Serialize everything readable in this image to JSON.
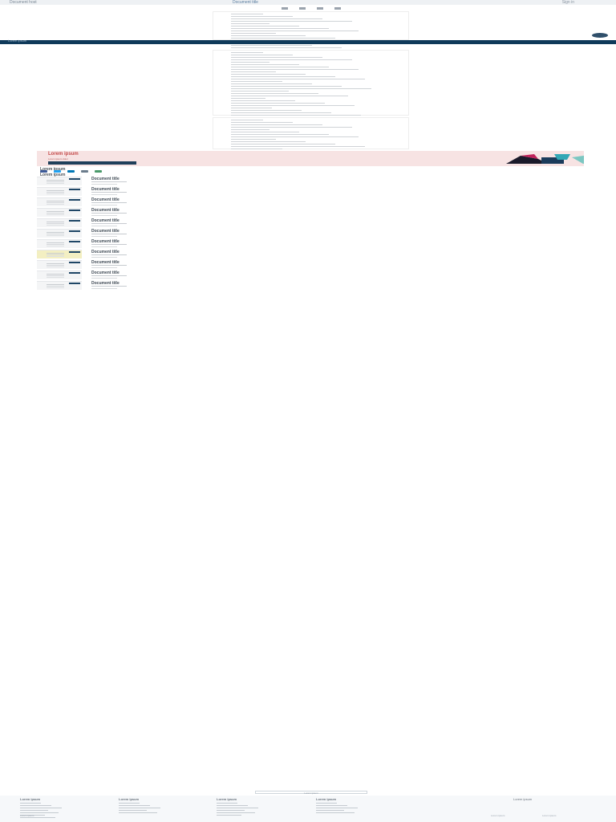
{
  "header": {
    "brand": "Document host",
    "title": "Document title",
    "sign_in": "Sign in",
    "nav_icons": [
      "zoom-out-icon",
      "zoom-in-icon",
      "fullscreen-icon",
      "download-icon"
    ]
  },
  "viewer": {
    "page_card_a_lines": 16,
    "page_card_b_lines": 36,
    "page_card_c_lines": 18
  },
  "navy": {
    "left_text": "Lorem ipsum"
  },
  "promo": {
    "title": "Lorem ipsum",
    "subtitle": "Lorem ipsum dolor",
    "cta": "Lorem ipsum",
    "colors": {
      "bg": "#f7e3e3",
      "title": "#c44a4a",
      "cta": "#1f3f5a"
    }
  },
  "share": {
    "heading": "Lorem ipsum",
    "icons": [
      "facebook-icon",
      "twitter-icon",
      "linkedin-icon",
      "email-icon",
      "link-icon"
    ],
    "colors": [
      "#3b5998",
      "#1da1f2",
      "#0077b5",
      "#6b7c8c",
      "#4a9a6a"
    ]
  },
  "might_like": {
    "heading": "Lorem ipsum"
  },
  "results": [
    {
      "title": "Document title",
      "yellow": false
    },
    {
      "title": "Document title",
      "yellow": false
    },
    {
      "title": "Document title",
      "yellow": false
    },
    {
      "title": "Document title",
      "yellow": false
    },
    {
      "title": "Document title",
      "yellow": false
    },
    {
      "title": "Document title",
      "yellow": false
    },
    {
      "title": "Document title",
      "yellow": false
    },
    {
      "title": "Document title",
      "yellow": true
    },
    {
      "title": "Document title",
      "yellow": false
    },
    {
      "title": "Document title",
      "yellow": false
    },
    {
      "title": "Document title",
      "yellow": false
    }
  ],
  "load_more": "Lorem ipsum",
  "footer": {
    "columns": [
      {
        "head": "Lorem ipsum",
        "links": 7
      },
      {
        "head": "Lorem ipsum",
        "links": 5
      },
      {
        "head": "Lorem ipsum",
        "links": 6
      },
      {
        "head": "Lorem ipsum",
        "links": 5
      }
    ],
    "app": "Lorem ipsum",
    "bottom": "Lorem ipsum",
    "language": "Lorem ipsum",
    "copyright": "Lorem ipsum"
  }
}
